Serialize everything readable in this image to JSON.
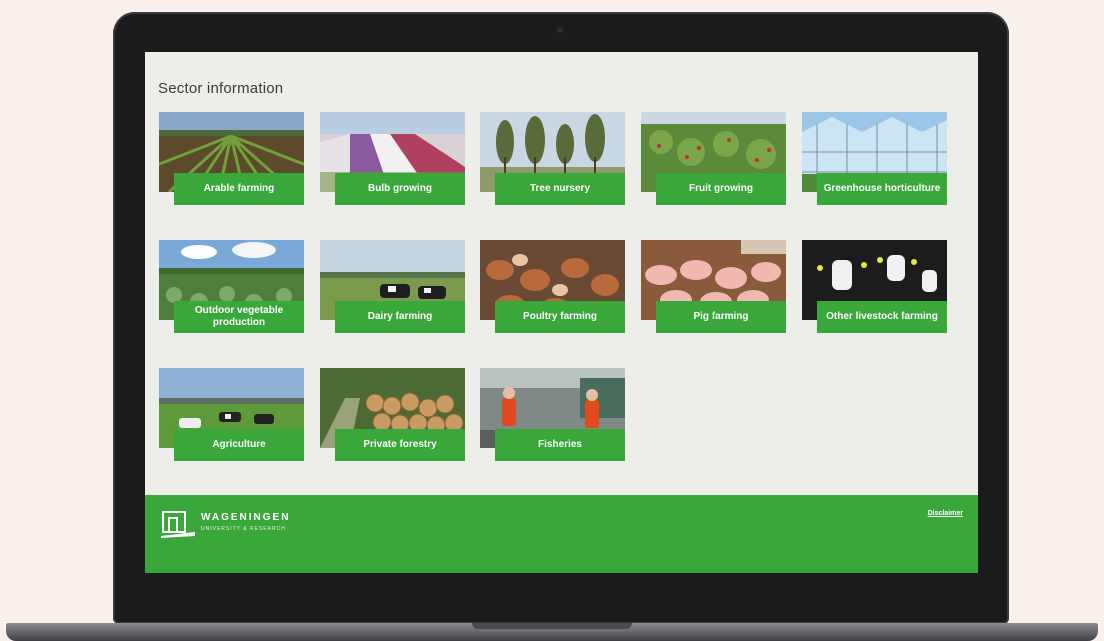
{
  "page": {
    "title": "Sector information"
  },
  "sectors": [
    {
      "label": "Arable farming",
      "image": "arable-field"
    },
    {
      "label": "Bulb growing",
      "image": "bulb-fields"
    },
    {
      "label": "Tree nursery",
      "image": "young-trees"
    },
    {
      "label": "Fruit growing",
      "image": "orchard"
    },
    {
      "label": "Greenhouse horticulture",
      "image": "greenhouse"
    },
    {
      "label": "Outdoor vegetable production",
      "image": "cabbage-field"
    },
    {
      "label": "Dairy farming",
      "image": "dairy-cows"
    },
    {
      "label": "Poultry farming",
      "image": "chickens"
    },
    {
      "label": "Pig farming",
      "image": "piglets"
    },
    {
      "label": "Other livestock farming",
      "image": "calves"
    },
    {
      "label": "Agriculture",
      "image": "cows-meadow"
    },
    {
      "label": "Private forestry",
      "image": "log-pile"
    },
    {
      "label": "Fisheries",
      "image": "fishermen"
    }
  ],
  "footer": {
    "logo_name": "WAGENINGEN",
    "logo_sub": "UNIVERSITY & RESEARCH",
    "disclaimer": "Disclaimer"
  },
  "colors": {
    "brand_green": "#3aa73a",
    "page_background": "#ededea"
  }
}
